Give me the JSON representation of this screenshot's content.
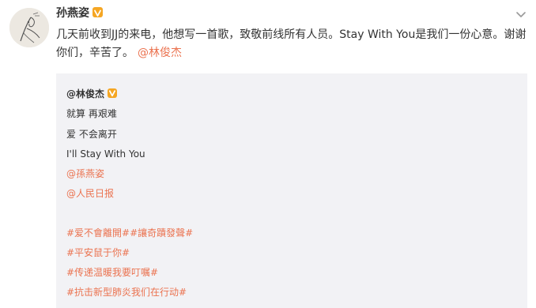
{
  "post": {
    "author_name": "孙燕姿",
    "text_main": "几天前收到JJ的来电，他想写一首歌，致敬前线所有人员。Stay With You是我们一份心意。谢谢你们，辛苦了。",
    "mention": "@林俊杰"
  },
  "repost": {
    "author": "@林俊杰",
    "lines": [
      "就算 再艰难",
      "爱 不会离开",
      "I'll Stay With You"
    ],
    "mentions": [
      "@孫燕姿",
      "@人民日报"
    ],
    "hashtags": [
      "#爱不會離開##讓奇蹟發聲#",
      "#平安鼠于你#",
      "#传递温暖我要叮嘱#",
      "#抗击新型肺炎我们在行动#"
    ]
  },
  "colors": {
    "link": "#eb7350",
    "text": "#333333",
    "repost_bg": "#f2f2f5",
    "vip_badge": "#f5a623"
  },
  "icons": {
    "avatar": "avatar-illustration",
    "badge": "verified-v-icon",
    "menu": "chevron-down-icon"
  }
}
